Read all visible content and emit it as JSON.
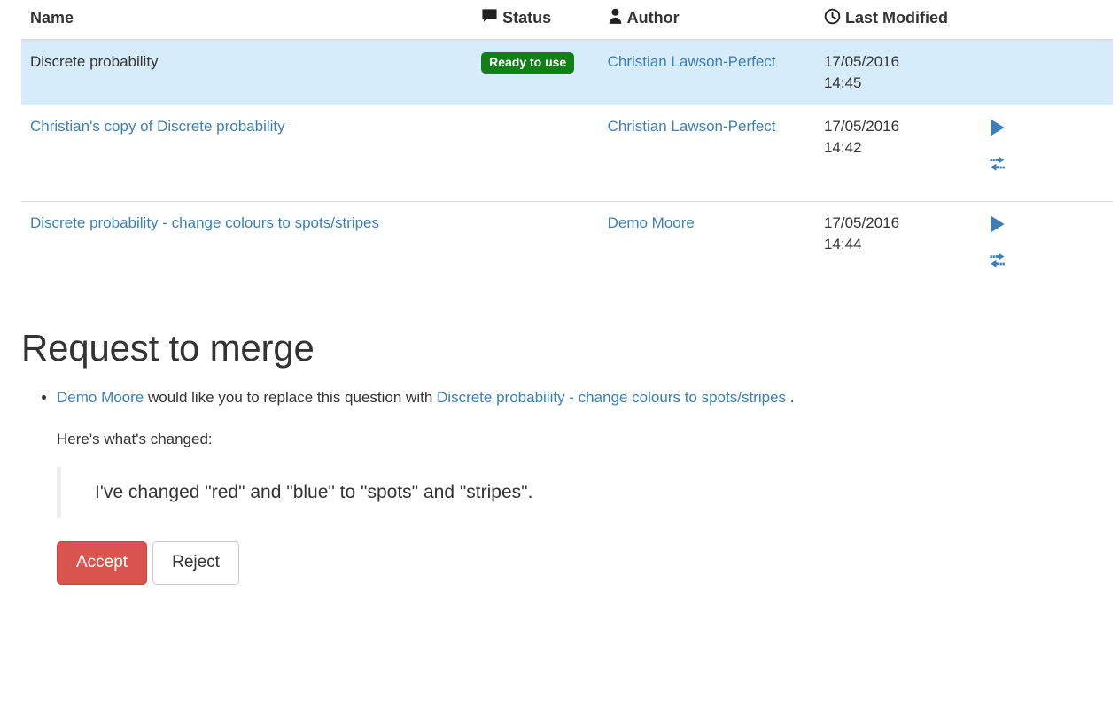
{
  "table": {
    "headers": [
      {
        "label": "Name",
        "icon": null,
        "key": "name"
      },
      {
        "label": "Status",
        "icon": "comment-icon",
        "key": "status"
      },
      {
        "label": "Author",
        "icon": "user-icon",
        "key": "author"
      },
      {
        "label": "Last Modified",
        "icon": "clock-icon",
        "key": "modified"
      }
    ],
    "header_name": "Name",
    "header_status": "Status",
    "header_author": "Author",
    "header_modified": "Last Modified",
    "rows": [
      {
        "name": "Discrete probability",
        "name_is_link": false,
        "status": "Ready to use",
        "author": "Christian Lawson-Perfect",
        "modified_date": "17/05/2016",
        "modified_time": "14:45",
        "highlighted": true,
        "actions": []
      },
      {
        "name": "Christian's copy of Discrete probability",
        "name_is_link": true,
        "status": "",
        "author": "Christian Lawson-Perfect",
        "modified_date": "17/05/2016",
        "modified_time": "14:42",
        "highlighted": false,
        "actions": [
          "play-icon",
          "exchange-icon"
        ]
      },
      {
        "name": "Discrete probability - change colours to spots/stripes",
        "name_is_link": true,
        "status": "",
        "author": "Demo Moore",
        "modified_date": "17/05/2016",
        "modified_time": "14:44",
        "highlighted": false,
        "actions": [
          "play-icon",
          "exchange-icon"
        ]
      }
    ]
  },
  "merge": {
    "title": "Request to merge",
    "requester": "Demo Moore",
    "sentence_middle": " would like you to replace this question with ",
    "target_question": "Discrete probability - change colours to spots/stripes",
    "sentence_end": " .",
    "changes_intro": "Here's what's changed:",
    "changes_body": "I've changed \"red\" and \"blue\" to \"spots\" and \"stripes\".",
    "accept_label": "Accept",
    "reject_label": "Reject"
  },
  "colors": {
    "link": "#3b7fb5",
    "badge_green": "#0f8117",
    "row_highlight": "#d6ecfb",
    "accept_red": "#d9534f",
    "icon_blue": "#3b7fb5",
    "border": "#dddddd"
  }
}
